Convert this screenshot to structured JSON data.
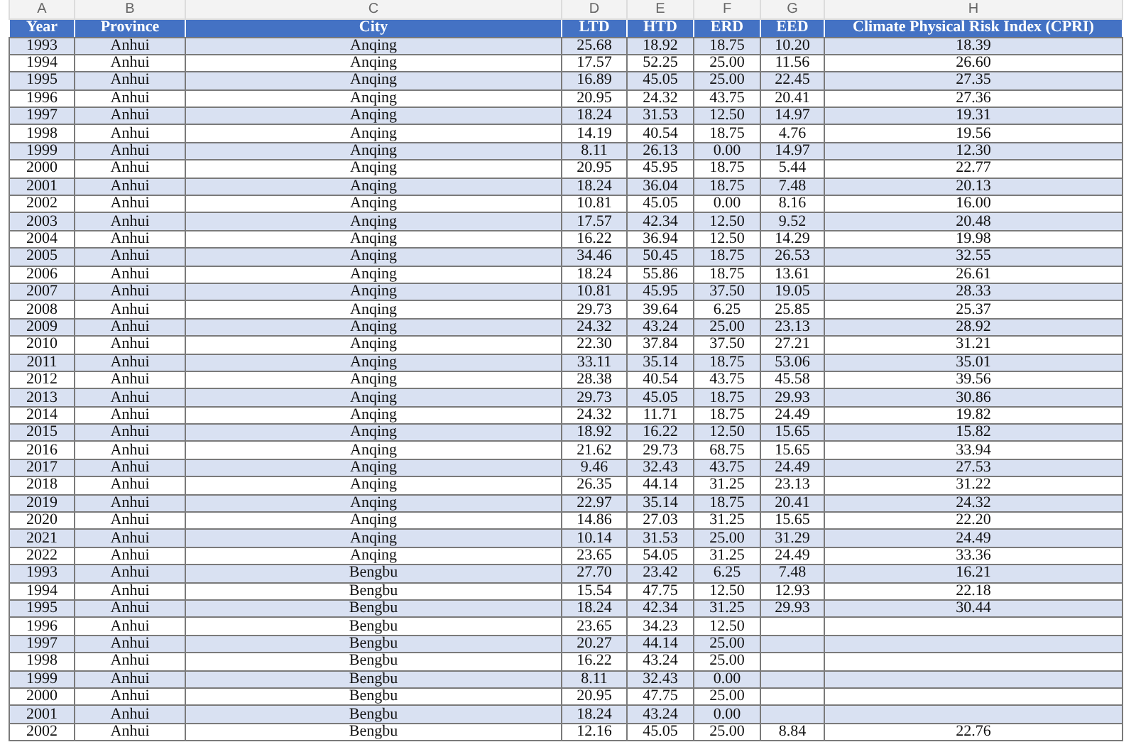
{
  "column_letters": [
    "A",
    "B",
    "C",
    "D",
    "E",
    "F",
    "G",
    "H"
  ],
  "table": {
    "columns": [
      "Year",
      "Province",
      "City",
      "LTD",
      "HTD",
      "ERD",
      "EED",
      "Climate Physical Risk Index (CPRI)"
    ],
    "rows": [
      [
        "1993",
        "Anhui",
        "Anqing",
        "25.68",
        "18.92",
        "18.75",
        "10.20",
        "18.39"
      ],
      [
        "1994",
        "Anhui",
        "Anqing",
        "17.57",
        "52.25",
        "25.00",
        "11.56",
        "26.60"
      ],
      [
        "1995",
        "Anhui",
        "Anqing",
        "16.89",
        "45.05",
        "25.00",
        "22.45",
        "27.35"
      ],
      [
        "1996",
        "Anhui",
        "Anqing",
        "20.95",
        "24.32",
        "43.75",
        "20.41",
        "27.36"
      ],
      [
        "1997",
        "Anhui",
        "Anqing",
        "18.24",
        "31.53",
        "12.50",
        "14.97",
        "19.31"
      ],
      [
        "1998",
        "Anhui",
        "Anqing",
        "14.19",
        "40.54",
        "18.75",
        "4.76",
        "19.56"
      ],
      [
        "1999",
        "Anhui",
        "Anqing",
        "8.11",
        "26.13",
        "0.00",
        "14.97",
        "12.30"
      ],
      [
        "2000",
        "Anhui",
        "Anqing",
        "20.95",
        "45.95",
        "18.75",
        "5.44",
        "22.77"
      ],
      [
        "2001",
        "Anhui",
        "Anqing",
        "18.24",
        "36.04",
        "18.75",
        "7.48",
        "20.13"
      ],
      [
        "2002",
        "Anhui",
        "Anqing",
        "10.81",
        "45.05",
        "0.00",
        "8.16",
        "16.00"
      ],
      [
        "2003",
        "Anhui",
        "Anqing",
        "17.57",
        "42.34",
        "12.50",
        "9.52",
        "20.48"
      ],
      [
        "2004",
        "Anhui",
        "Anqing",
        "16.22",
        "36.94",
        "12.50",
        "14.29",
        "19.98"
      ],
      [
        "2005",
        "Anhui",
        "Anqing",
        "34.46",
        "50.45",
        "18.75",
        "26.53",
        "32.55"
      ],
      [
        "2006",
        "Anhui",
        "Anqing",
        "18.24",
        "55.86",
        "18.75",
        "13.61",
        "26.61"
      ],
      [
        "2007",
        "Anhui",
        "Anqing",
        "10.81",
        "45.95",
        "37.50",
        "19.05",
        "28.33"
      ],
      [
        "2008",
        "Anhui",
        "Anqing",
        "29.73",
        "39.64",
        "6.25",
        "25.85",
        "25.37"
      ],
      [
        "2009",
        "Anhui",
        "Anqing",
        "24.32",
        "43.24",
        "25.00",
        "23.13",
        "28.92"
      ],
      [
        "2010",
        "Anhui",
        "Anqing",
        "22.30",
        "37.84",
        "37.50",
        "27.21",
        "31.21"
      ],
      [
        "2011",
        "Anhui",
        "Anqing",
        "33.11",
        "35.14",
        "18.75",
        "53.06",
        "35.01"
      ],
      [
        "2012",
        "Anhui",
        "Anqing",
        "28.38",
        "40.54",
        "43.75",
        "45.58",
        "39.56"
      ],
      [
        "2013",
        "Anhui",
        "Anqing",
        "29.73",
        "45.05",
        "18.75",
        "29.93",
        "30.86"
      ],
      [
        "2014",
        "Anhui",
        "Anqing",
        "24.32",
        "11.71",
        "18.75",
        "24.49",
        "19.82"
      ],
      [
        "2015",
        "Anhui",
        "Anqing",
        "18.92",
        "16.22",
        "12.50",
        "15.65",
        "15.82"
      ],
      [
        "2016",
        "Anhui",
        "Anqing",
        "21.62",
        "29.73",
        "68.75",
        "15.65",
        "33.94"
      ],
      [
        "2017",
        "Anhui",
        "Anqing",
        "9.46",
        "32.43",
        "43.75",
        "24.49",
        "27.53"
      ],
      [
        "2018",
        "Anhui",
        "Anqing",
        "26.35",
        "44.14",
        "31.25",
        "23.13",
        "31.22"
      ],
      [
        "2019",
        "Anhui",
        "Anqing",
        "22.97",
        "35.14",
        "18.75",
        "20.41",
        "24.32"
      ],
      [
        "2020",
        "Anhui",
        "Anqing",
        "14.86",
        "27.03",
        "31.25",
        "15.65",
        "22.20"
      ],
      [
        "2021",
        "Anhui",
        "Anqing",
        "10.14",
        "31.53",
        "25.00",
        "31.29",
        "24.49"
      ],
      [
        "2022",
        "Anhui",
        "Anqing",
        "23.65",
        "54.05",
        "31.25",
        "24.49",
        "33.36"
      ],
      [
        "1993",
        "Anhui",
        "Bengbu",
        "27.70",
        "23.42",
        "6.25",
        "7.48",
        "16.21"
      ],
      [
        "1994",
        "Anhui",
        "Bengbu",
        "15.54",
        "47.75",
        "12.50",
        "12.93",
        "22.18"
      ],
      [
        "1995",
        "Anhui",
        "Bengbu",
        "18.24",
        "42.34",
        "31.25",
        "29.93",
        "30.44"
      ],
      [
        "1996",
        "Anhui",
        "Bengbu",
        "23.65",
        "34.23",
        "12.50",
        null,
        null
      ],
      [
        "1997",
        "Anhui",
        "Bengbu",
        "20.27",
        "44.14",
        "25.00",
        null,
        null
      ],
      [
        "1998",
        "Anhui",
        "Bengbu",
        "16.22",
        "43.24",
        "25.00",
        null,
        null
      ],
      [
        "1999",
        "Anhui",
        "Bengbu",
        "8.11",
        "32.43",
        "0.00",
        null,
        null
      ],
      [
        "2000",
        "Anhui",
        "Bengbu",
        "20.95",
        "47.75",
        "25.00",
        null,
        null
      ],
      [
        "2001",
        "Anhui",
        "Bengbu",
        "18.24",
        "43.24",
        "0.00",
        null,
        null
      ],
      [
        "2002",
        "Anhui",
        "Bengbu",
        "12.16",
        "45.05",
        "25.00",
        "8.84",
        "22.76"
      ]
    ]
  }
}
